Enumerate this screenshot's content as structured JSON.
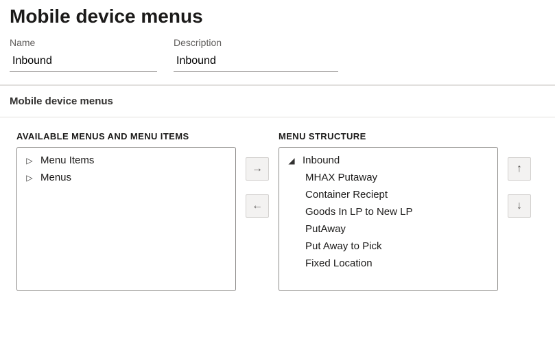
{
  "page": {
    "title": "Mobile device menus"
  },
  "fields": {
    "name": {
      "label": "Name",
      "value": "Inbound"
    },
    "description": {
      "label": "Description",
      "value": "Inbound"
    }
  },
  "fasttab": {
    "title": "Mobile device menus"
  },
  "available": {
    "header": "AVAILABLE MENUS AND MENU ITEMS",
    "items": [
      {
        "label": "Menu Items",
        "expanded": false
      },
      {
        "label": "Menus",
        "expanded": false
      }
    ]
  },
  "structure": {
    "header": "MENU STRUCTURE",
    "root": {
      "label": "Inbound",
      "expanded": true
    },
    "children": [
      {
        "label": "MHAX Putaway"
      },
      {
        "label": "Container Reciept"
      },
      {
        "label": "Goods In LP to New LP"
      },
      {
        "label": "PutAway"
      },
      {
        "label": "Put Away to Pick"
      },
      {
        "label": "Fixed Location"
      }
    ]
  },
  "glyphs": {
    "collapsed": "▷",
    "expanded": "◢"
  }
}
